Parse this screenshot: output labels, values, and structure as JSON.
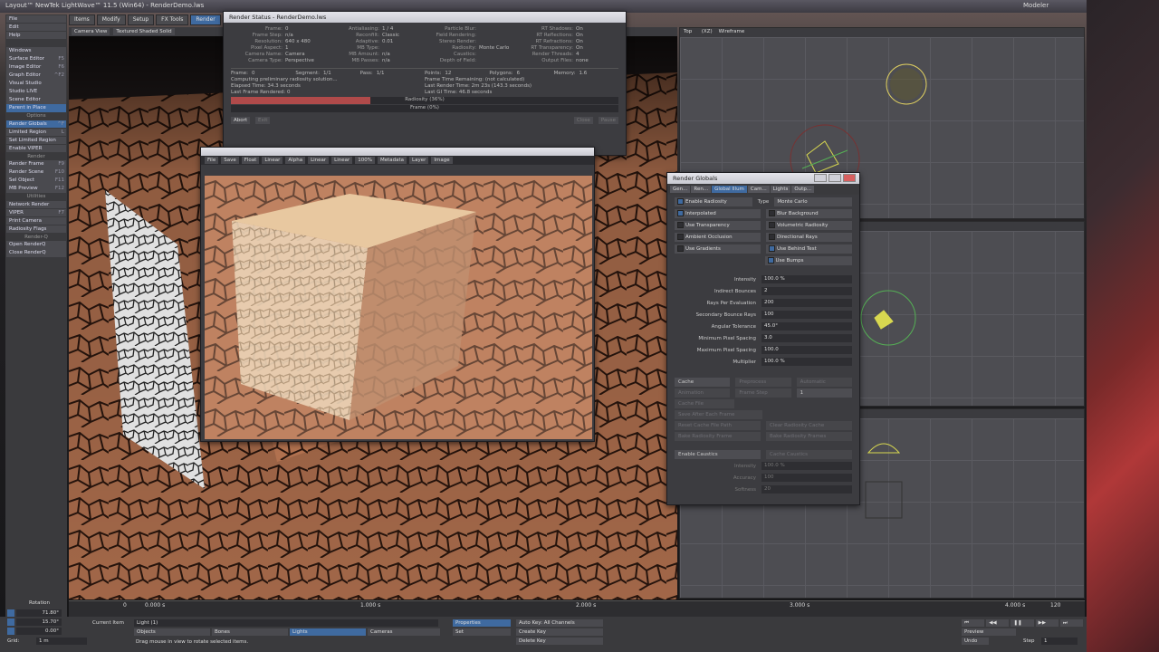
{
  "app": {
    "title": "Layout™ NewTek LightWave™ 11.5 (Win64) - RenderDemo.lws",
    "modeler_label": "Modeler"
  },
  "menu_tabs": [
    {
      "label": "Items"
    },
    {
      "label": "Modify"
    },
    {
      "label": "Setup"
    },
    {
      "label": "FX Tools"
    },
    {
      "label": "Render"
    }
  ],
  "viewport": {
    "camera_view": "Camera View",
    "shading": "Textured Shaded Solid"
  },
  "left_panel": {
    "top_items": [
      {
        "label": "File"
      },
      {
        "label": "Edit"
      },
      {
        "label": "Help"
      }
    ],
    "windows_items": [
      {
        "label": "Windows"
      },
      {
        "label": "Surface Editor",
        "shortcut": "F5"
      },
      {
        "label": "Image Editor",
        "shortcut": "F6"
      },
      {
        "label": "Graph Editor",
        "shortcut": "^F2"
      },
      {
        "label": "Visual Studio",
        "shortcut": ""
      },
      {
        "label": "Studio LIVE",
        "shortcut": ""
      },
      {
        "label": "Scene Editor",
        "shortcut": ""
      }
    ],
    "parent_label": "Parent in Place",
    "options_header": "Options",
    "options_items": [
      {
        "label": "Render Globals",
        "shortcut": "^F",
        "active": true
      },
      {
        "label": "Limited Region",
        "shortcut": "L"
      },
      {
        "label": "Set Limited Region",
        "shortcut": ""
      },
      {
        "label": "Enable VIPER",
        "shortcut": ""
      }
    ],
    "render_header": "Render",
    "render_items": [
      {
        "label": "Render Frame",
        "shortcut": "F9"
      },
      {
        "label": "Render Scene",
        "shortcut": "F10"
      },
      {
        "label": "Sel Object",
        "shortcut": "F11"
      },
      {
        "label": "MB Preview",
        "shortcut": "F12"
      }
    ],
    "utilities_header": "Utilities",
    "utilities_items": [
      {
        "label": "Network Render"
      },
      {
        "label": "VIPER",
        "shortcut": "F7"
      },
      {
        "label": "Print Camera"
      },
      {
        "label": "Radiosity Flags"
      }
    ],
    "renderq_header": "Render-Q",
    "renderq_items": [
      {
        "label": "Open RenderQ"
      },
      {
        "label": "Close RenderQ"
      }
    ]
  },
  "render_status": {
    "title": "Render Status - RenderDemo.lws",
    "col1": [
      {
        "k": "Frame:",
        "v": "0"
      },
      {
        "k": "Frame Step:",
        "v": "n/a"
      },
      {
        "k": "Resolution:",
        "v": "640 x 480"
      },
      {
        "k": "Pixel Aspect:",
        "v": "1"
      },
      {
        "k": "Camera Name:",
        "v": "Camera"
      },
      {
        "k": "Camera Type:",
        "v": "Perspective"
      }
    ],
    "col2": [
      {
        "k": "Antialiasing:",
        "v": "1 / 4"
      },
      {
        "k": "Reconfilt:",
        "v": "Classic"
      },
      {
        "k": "Adaptive:",
        "v": "0.01"
      },
      {
        "k": "MB Type:",
        "v": ""
      },
      {
        "k": "MB Amount:",
        "v": "n/a"
      },
      {
        "k": "MB Passes:",
        "v": "n/a"
      }
    ],
    "col3": [
      {
        "k": "Particle Blur:",
        "v": ""
      },
      {
        "k": "Field Rendering:",
        "v": ""
      },
      {
        "k": "Stereo Render:",
        "v": ""
      },
      {
        "k": "Radiosity:",
        "v": "Monte Carlo"
      },
      {
        "k": "Caustics:",
        "v": ""
      },
      {
        "k": "Depth of Field:",
        "v": ""
      }
    ],
    "col4": [
      {
        "k": "RT Shadows:",
        "v": "On"
      },
      {
        "k": "RT Reflections:",
        "v": "On"
      },
      {
        "k": "RT Refractions:",
        "v": "On"
      },
      {
        "k": "RT Transparency:",
        "v": "On"
      },
      {
        "k": "Render Threads:",
        "v": "4"
      },
      {
        "k": "Output Files:",
        "v": "none"
      }
    ],
    "stats": [
      {
        "k": "Frame:",
        "v": "0"
      },
      {
        "k": "Segment:",
        "v": "1/1"
      },
      {
        "k": "Pass:",
        "v": "1/1"
      },
      {
        "k": "Points:",
        "v": "12"
      },
      {
        "k": "Polygons:",
        "v": "6"
      },
      {
        "k": "Memory:",
        "v": "1.6"
      }
    ],
    "computing": "Computing preliminary radiosity solution...",
    "elapsed": "Elapsed Time: 34.3 seconds",
    "last_frame": "Last Frame Rendered: 0",
    "frame_remaining": "Frame Time Remaining: (not calculated)",
    "last_render_time": "Last Render Time: 2m 23s (143.3 seconds)",
    "last_gi_time": "Last GI Time: 46.8 seconds",
    "radiosity_progress_label": "Radiosity (36%)",
    "radiosity_progress": 0.36,
    "frame_progress_label": "Frame (0%)",
    "abort_label": "Abort",
    "exit_label": "Exit",
    "close_label": "Close",
    "pause_label": "Pause"
  },
  "image_viewer": {
    "toolbar": [
      "File",
      "Save",
      "Float",
      "Linear",
      "Alpha",
      "Linear",
      "Linear",
      "100%",
      "Metadata",
      "Layer",
      "Image"
    ]
  },
  "quad_views": {
    "top_label": "Top",
    "axis_label": "(XZ)",
    "mode_label": "Wireframe"
  },
  "render_globals": {
    "title": "Render Globals",
    "tabs": [
      {
        "label": "Gen..."
      },
      {
        "label": "Ren..."
      },
      {
        "label": "Global Illum",
        "active": true
      },
      {
        "label": "Cam..."
      },
      {
        "label": "Lights"
      },
      {
        "label": "Outp..."
      }
    ],
    "enable_radiosity": "Enable Radiosity",
    "type_label": "Type",
    "type_value": "Monte Carlo",
    "checks": [
      {
        "left": "Interpolated",
        "left_on": true,
        "right": "Blur Background",
        "right_on": false
      },
      {
        "left": "Use Transparency",
        "left_on": false,
        "right": "Volumetric Radiosity",
        "right_on": false
      },
      {
        "left": "Ambient Occlusion",
        "left_on": false,
        "right": "Directional Rays",
        "right_on": false
      },
      {
        "left": "Use Gradients",
        "left_on": false,
        "right": "Use Behind Test",
        "right_on": true
      },
      {
        "left": "",
        "left_on": false,
        "right": "Use Bumps",
        "right_on": true
      }
    ],
    "fields": [
      {
        "label": "Intensity",
        "value": "100.0 %"
      },
      {
        "label": "Indirect Bounces",
        "value": "2"
      },
      {
        "label": "Rays Per Evaluation",
        "value": "200"
      },
      {
        "label": "Secondary Bounce Rays",
        "value": "100"
      },
      {
        "label": "Angular Tolerance",
        "value": "45.0°"
      },
      {
        "label": "Minimum Pixel Spacing",
        "value": "3.0"
      },
      {
        "label": "Maximum Pixel Spacing",
        "value": "100.0"
      },
      {
        "label": "Multiplier",
        "value": "100.0 %"
      }
    ],
    "cache_label": "Cache",
    "preprocess_label": "Preprocess",
    "preprocess_value": "Automatic",
    "animation_label": "Animation",
    "frame_step_label": "Frame Step",
    "frame_step_value": "1",
    "cache_file_label": "Cache File",
    "save_after_label": "Save After Each Frame",
    "reset_cache_label": "Reset Cache File Path",
    "clear_cache_label": "Clear Radiosity Cache",
    "bake_radiosity_label": "Bake Radiosity Frame",
    "bake_radiosity2_label": "Bake Radiosity Frames",
    "enable_caustics": "Enable Caustics",
    "cache_caustics": "Cache Caustics",
    "caustics_fields": [
      {
        "label": "Intensity",
        "value": "100.0 %"
      },
      {
        "label": "Accuracy",
        "value": "100"
      },
      {
        "label": "Softness",
        "value": "20"
      }
    ]
  },
  "timeline": {
    "rotation_label": "Rotation",
    "ticks": [
      "0",
      "0.000 s",
      "1.000 s",
      "2.000 s",
      "3.000 s",
      "4.000 s"
    ],
    "end_value": "120"
  },
  "bottom": {
    "h": "71.80°",
    "p": "15.70°",
    "b": "0.00°",
    "grid_label": "Grid:",
    "grid_value": "1 m",
    "current_item_label": "Current Item",
    "current_item_value": "Light (1)",
    "objects_label": "Objects",
    "bones_label": "Bones",
    "lights_label": "Lights",
    "cameras_label": "Cameras",
    "properties_label": "Properties",
    "set_label": "Set",
    "auto_key_label": "Auto Key: All Channels",
    "create_key_label": "Create Key",
    "delete_key_label": "Delete Key",
    "status_message": "Drag mouse in view to rotate selected items.",
    "preview_label": "Preview",
    "undo_label": "Undo",
    "step_label": "Step",
    "step_value": "1"
  }
}
